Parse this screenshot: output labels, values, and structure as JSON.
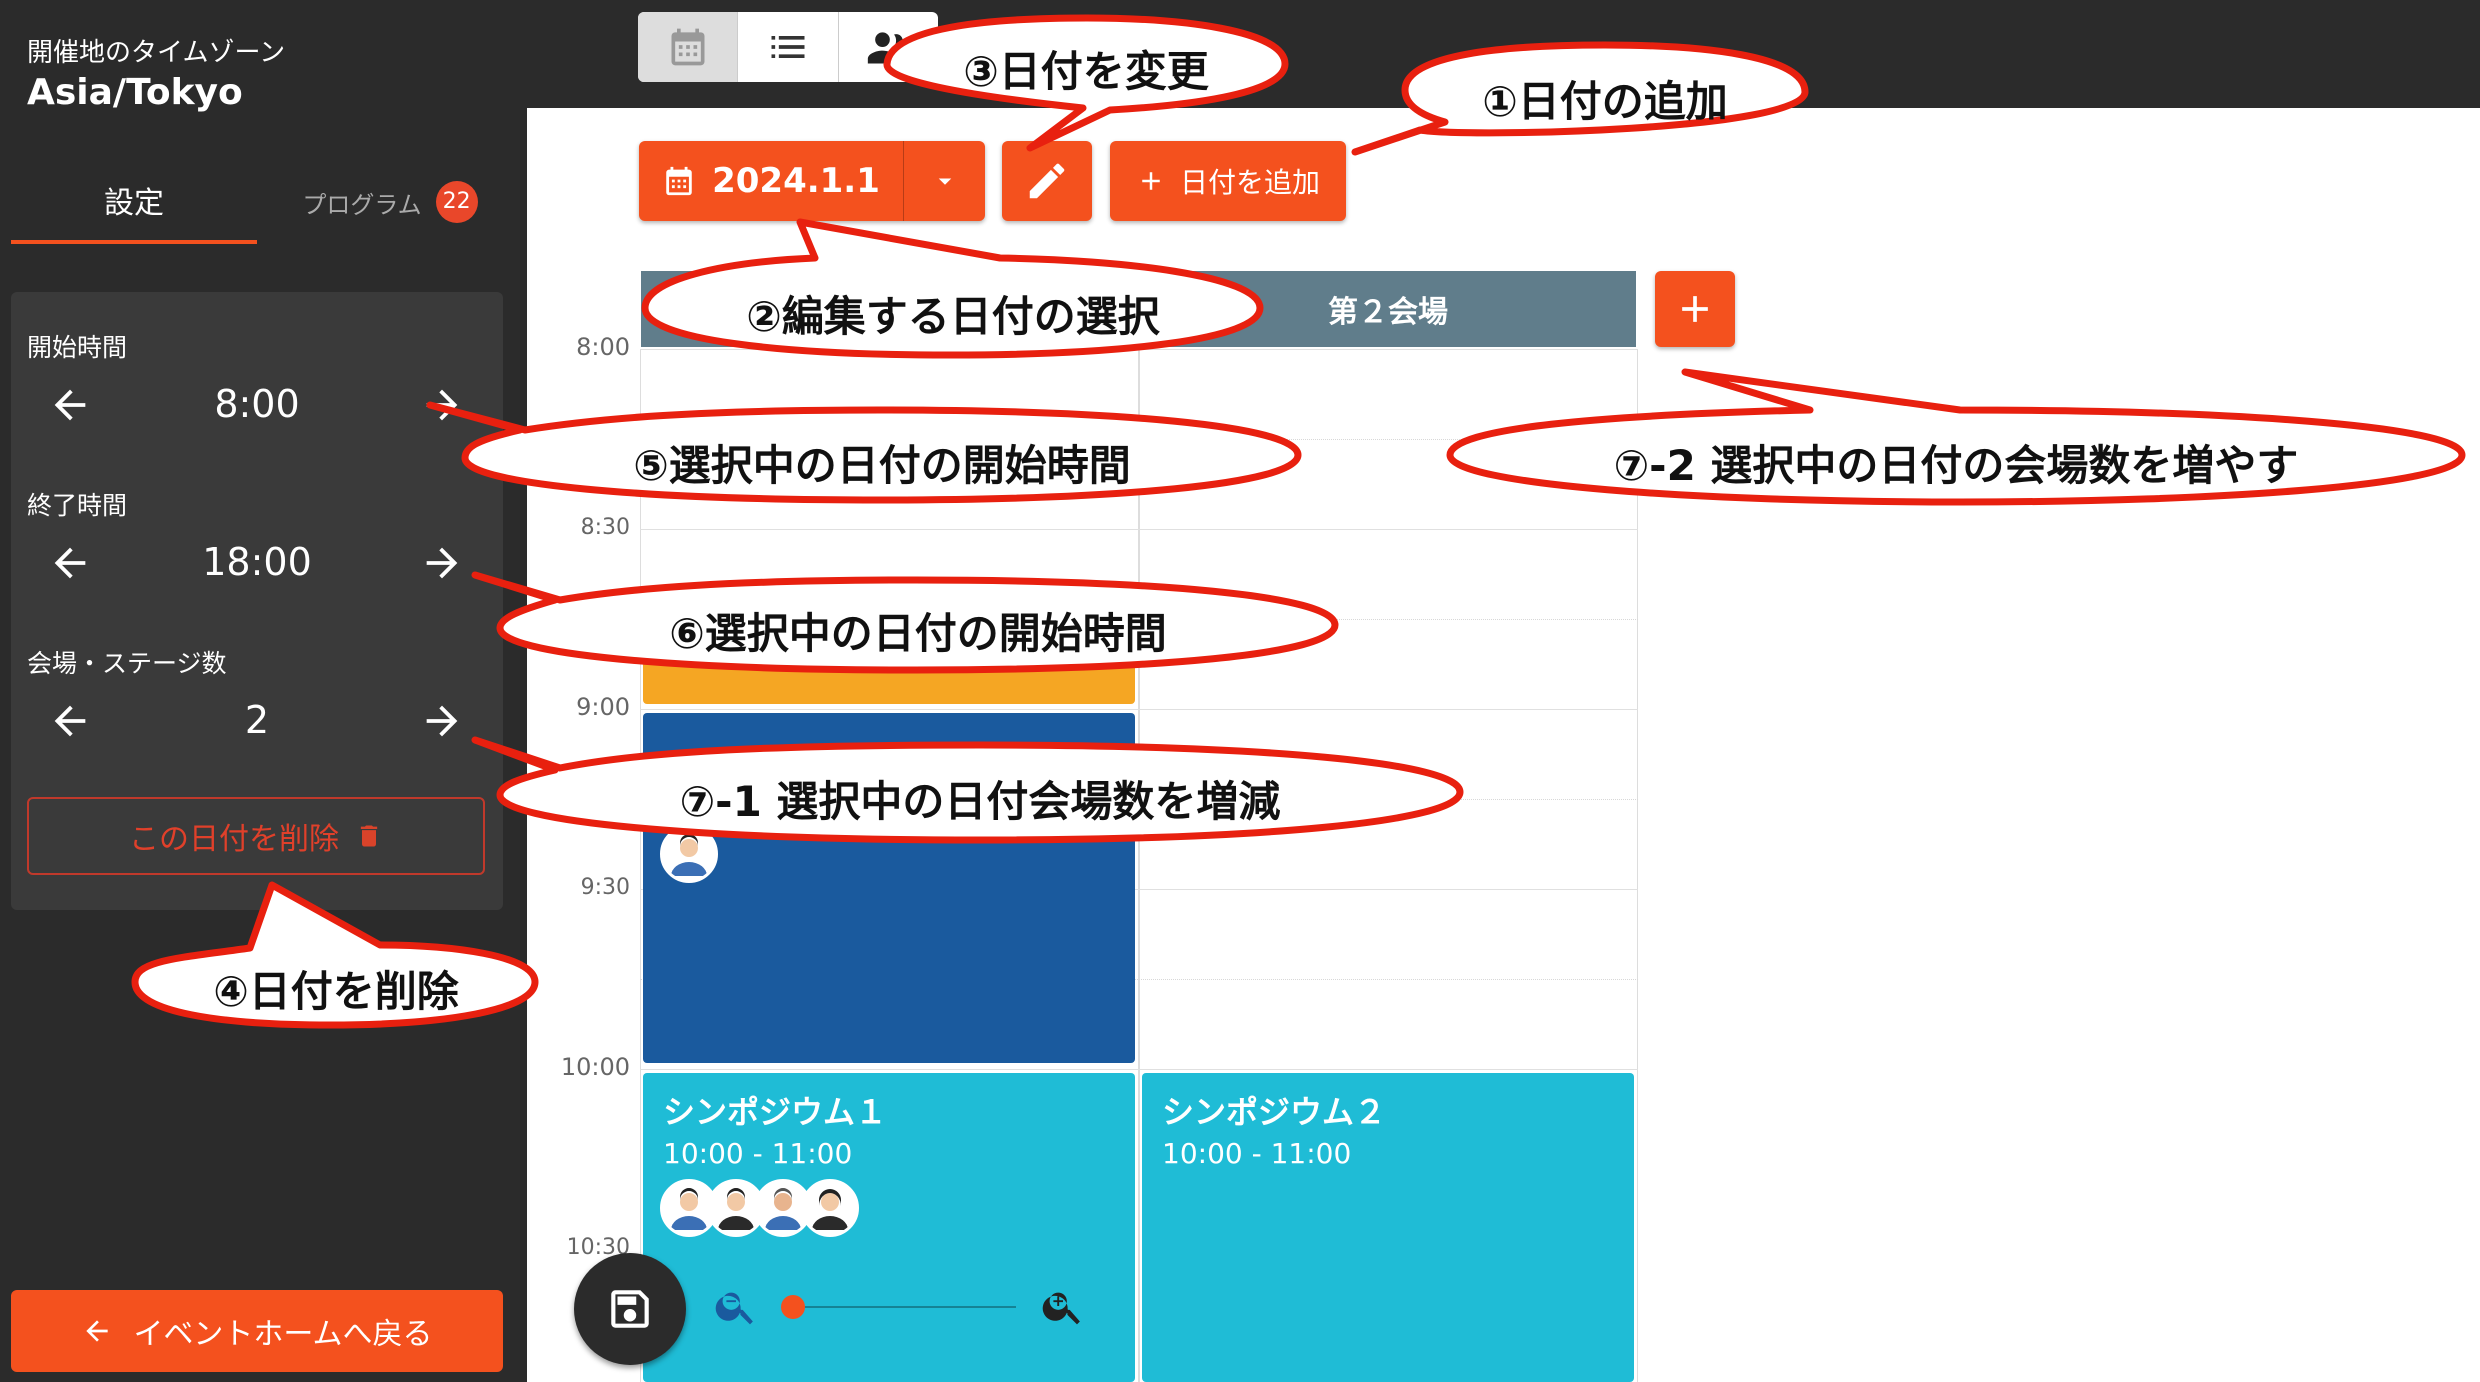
{
  "sidebar": {
    "timezone_label": "開催地のタイムゾーン",
    "timezone": "Asia/Tokyo",
    "tabs": [
      {
        "label": "設定"
      },
      {
        "label": "プログラム",
        "badge": "22"
      }
    ],
    "start_time": {
      "label": "開始時間",
      "value": "8:00"
    },
    "end_time": {
      "label": "終了時間",
      "value": "18:00"
    },
    "venues": {
      "label": "会場・ステージ数",
      "value": "2"
    },
    "delete_label": "この日付を削除",
    "back_label": "イベントホームへ戻る"
  },
  "toolbar": {
    "date": "2024.1.1",
    "add_date_label": "日付を追加"
  },
  "calendar": {
    "venue_2": "第２会場",
    "times": [
      "8:00",
      "8:30",
      "9:00",
      "9:30",
      "10:00",
      "10:30"
    ],
    "events": [
      {
        "title": "シンポジウム１",
        "time": "10:00 - 11:00"
      },
      {
        "title": "シンポジウム２",
        "time": "10:00 - 11:00"
      }
    ]
  },
  "callouts": {
    "add_date": "①日付の追加",
    "select_date": "②編集する日付の選択",
    "change_date": "③日付を変更",
    "delete_date": "④日付を削除",
    "start_time": "⑤選択中の日付の開始時間",
    "end_time": "⑥選択中の日付の開始時間",
    "venues_inc_dec": "⑦-1 選択中の日付会場数を増減",
    "venues_inc": "⑦-2 選択中の日付の会場数を増やす"
  },
  "colors": {
    "accent": "#f4511e",
    "sidebar": "#2b2b2b",
    "venue_header": "#607d8b",
    "event_orange": "#f5a623",
    "event_blue": "#1a5a9e",
    "event_cyan": "#1fbcd6"
  }
}
